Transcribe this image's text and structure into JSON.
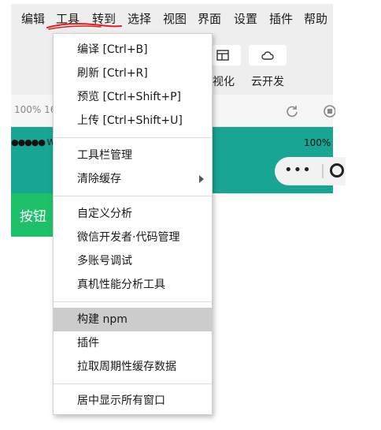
{
  "menubar": {
    "items": [
      "编辑",
      "工具",
      "转到",
      "选择",
      "视图",
      "界面",
      "设置",
      "插件",
      "帮助"
    ],
    "active_index": 1
  },
  "toolbar": {
    "visualize_label": "视化",
    "cloud_label": "云开发"
  },
  "zoom": {
    "text": "100% 16"
  },
  "simulator": {
    "signal": "●●●●● W",
    "battery": "100%",
    "capsule_dots": "•••",
    "button_label": "按钮",
    "header_color": "#18a594",
    "button_color": "#1ec06a"
  },
  "tools_menu": {
    "items": [
      {
        "label": "编译  [Ctrl+B]"
      },
      {
        "label": "刷新  [Ctrl+R]"
      },
      {
        "label": "预览  [Ctrl+Shift+P]"
      },
      {
        "label": "上传  [Ctrl+Shift+U]"
      },
      {
        "label": "工具栏管理"
      },
      {
        "label": "清除缓存",
        "has_submenu": true
      },
      {
        "label": "自定义分析"
      },
      {
        "label": "微信开发者·代码管理"
      },
      {
        "label": "多账号调试"
      },
      {
        "label": "真机性能分析工具"
      },
      {
        "label": "构建 npm",
        "highlighted": true
      },
      {
        "label": "插件"
      },
      {
        "label": "拉取周期性缓存数据"
      },
      {
        "label": "居中显示所有窗口"
      }
    ]
  }
}
